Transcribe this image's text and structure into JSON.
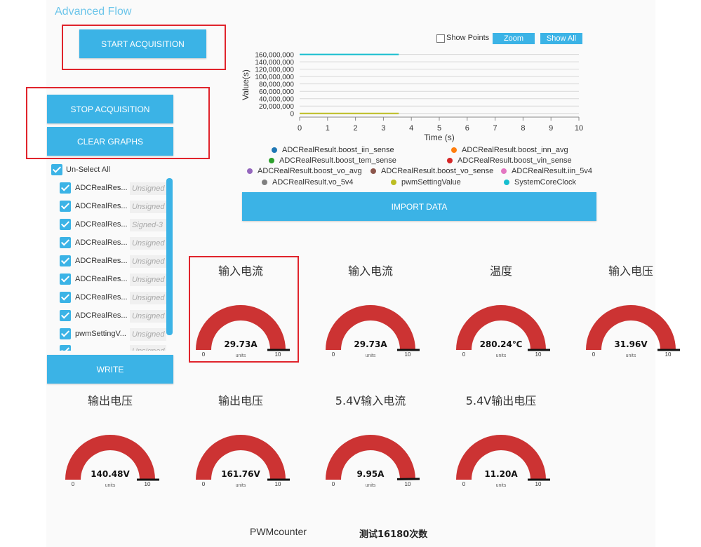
{
  "app": {
    "title": "Advanced Flow"
  },
  "buttons": {
    "start": "START ACQUISITION",
    "stop": "STOP ACQUISITION",
    "clear": "CLEAR GRAPHS",
    "write": "WRITE",
    "import": "IMPORT DATA"
  },
  "variables": {
    "select_all_label": "Un-Select All",
    "items": [
      {
        "label": "ADCRealRes...",
        "type": "Unsigned"
      },
      {
        "label": "ADCRealRes...",
        "type": "Unsigned"
      },
      {
        "label": "ADCRealRes...",
        "type": "Signed-3"
      },
      {
        "label": "ADCRealRes...",
        "type": "Unsigned"
      },
      {
        "label": "ADCRealRes...",
        "type": "Unsigned"
      },
      {
        "label": "ADCRealRes...",
        "type": "Unsigned"
      },
      {
        "label": "ADCRealRes...",
        "type": "Unsigned"
      },
      {
        "label": "ADCRealRes...",
        "type": "Unsigned"
      },
      {
        "label": "pwmSettingV...",
        "type": "Unsigned"
      },
      {
        "label": "",
        "type": "Unsigned"
      }
    ]
  },
  "chart_controls": {
    "show_points_label": "Show Points",
    "show_points_checked": false,
    "zoom_label": "Zoom",
    "show_all_label": "Show All"
  },
  "chart_data": {
    "type": "line",
    "xlabel": "Time (s)",
    "ylabel": "Value(s)",
    "xlim": [
      0,
      10
    ],
    "ylim": [
      -10000000,
      165000000
    ],
    "x_ticks": [
      "0",
      "1",
      "2",
      "3",
      "4",
      "5",
      "6",
      "7",
      "8",
      "9",
      "10"
    ],
    "y_ticks": [
      "160,000,000",
      "140,000,000",
      "120,000,000",
      "100,000,000",
      "80,000,000",
      "60,000,000",
      "40,000,000",
      "20,000,000",
      "0"
    ],
    "grid": true,
    "legend_position": "bottom",
    "series": [
      {
        "name": "ADCRealResult.boost_iin_sense",
        "color": "#1f77b4",
        "x": [],
        "y": []
      },
      {
        "name": "ADCRealResult.boost_inn_avg",
        "color": "#ff7f0e",
        "x": [],
        "y": []
      },
      {
        "name": "ADCRealResult.boost_tem_sense",
        "color": "#2ca02c",
        "x": [],
        "y": []
      },
      {
        "name": "ADCRealResult.boost_vin_sense",
        "color": "#d62728",
        "x": [],
        "y": []
      },
      {
        "name": "ADCRealResult.boost_vo_avg",
        "color": "#9467bd",
        "x": [],
        "y": []
      },
      {
        "name": "ADCRealResult.boost_vo_sense",
        "color": "#8c564b",
        "x": [],
        "y": []
      },
      {
        "name": "ADCRealResult.iin_5v4",
        "color": "#e377c2",
        "x": [],
        "y": []
      },
      {
        "name": "ADCRealResult.vo_5v4",
        "color": "#7f7f7f",
        "x": [],
        "y": []
      },
      {
        "name": "pwmSettingValue",
        "color": "#bcbd22",
        "x": [
          0,
          3.55
        ],
        "y": [
          0,
          0
        ]
      },
      {
        "name": "SystemCoreClock",
        "color": "#17becf",
        "x": [
          0,
          3.55
        ],
        "y": [
          160000000,
          160000000
        ]
      }
    ]
  },
  "gauges": [
    {
      "title": "输入电流",
      "value": "29.73A",
      "min": "0",
      "max": "10",
      "units": "units",
      "level": 1.0
    },
    {
      "title": "输入电流",
      "value": "29.73A",
      "min": "0",
      "max": "10",
      "units": "units",
      "level": 1.0
    },
    {
      "title": "温度",
      "value": "280.24℃",
      "min": "0",
      "max": "10",
      "units": "units",
      "level": 1.0
    },
    {
      "title": "输入电压",
      "value": "31.96V",
      "min": "0",
      "max": "10",
      "units": "units",
      "level": 1.0
    },
    {
      "title": "输出电压",
      "value": "140.48V",
      "min": "0",
      "max": "10",
      "units": "units",
      "level": 1.0
    },
    {
      "title": "输出电压",
      "value": "161.76V",
      "min": "0",
      "max": "10",
      "units": "units",
      "level": 1.0
    },
    {
      "title": "5.4V输入电流",
      "value": "9.95A",
      "min": "0",
      "max": "10",
      "units": "units",
      "level": 0.995
    },
    {
      "title": "5.4V输出电压",
      "value": "11.20A",
      "min": "0",
      "max": "10",
      "units": "units",
      "level": 1.0
    }
  ],
  "colors": {
    "accent": "#3bb3e6",
    "gauge_fill": "#cc3333",
    "highlight": "#e0242c"
  },
  "footer": {
    "label": "PWMcounter",
    "value": "测试16180次数"
  }
}
